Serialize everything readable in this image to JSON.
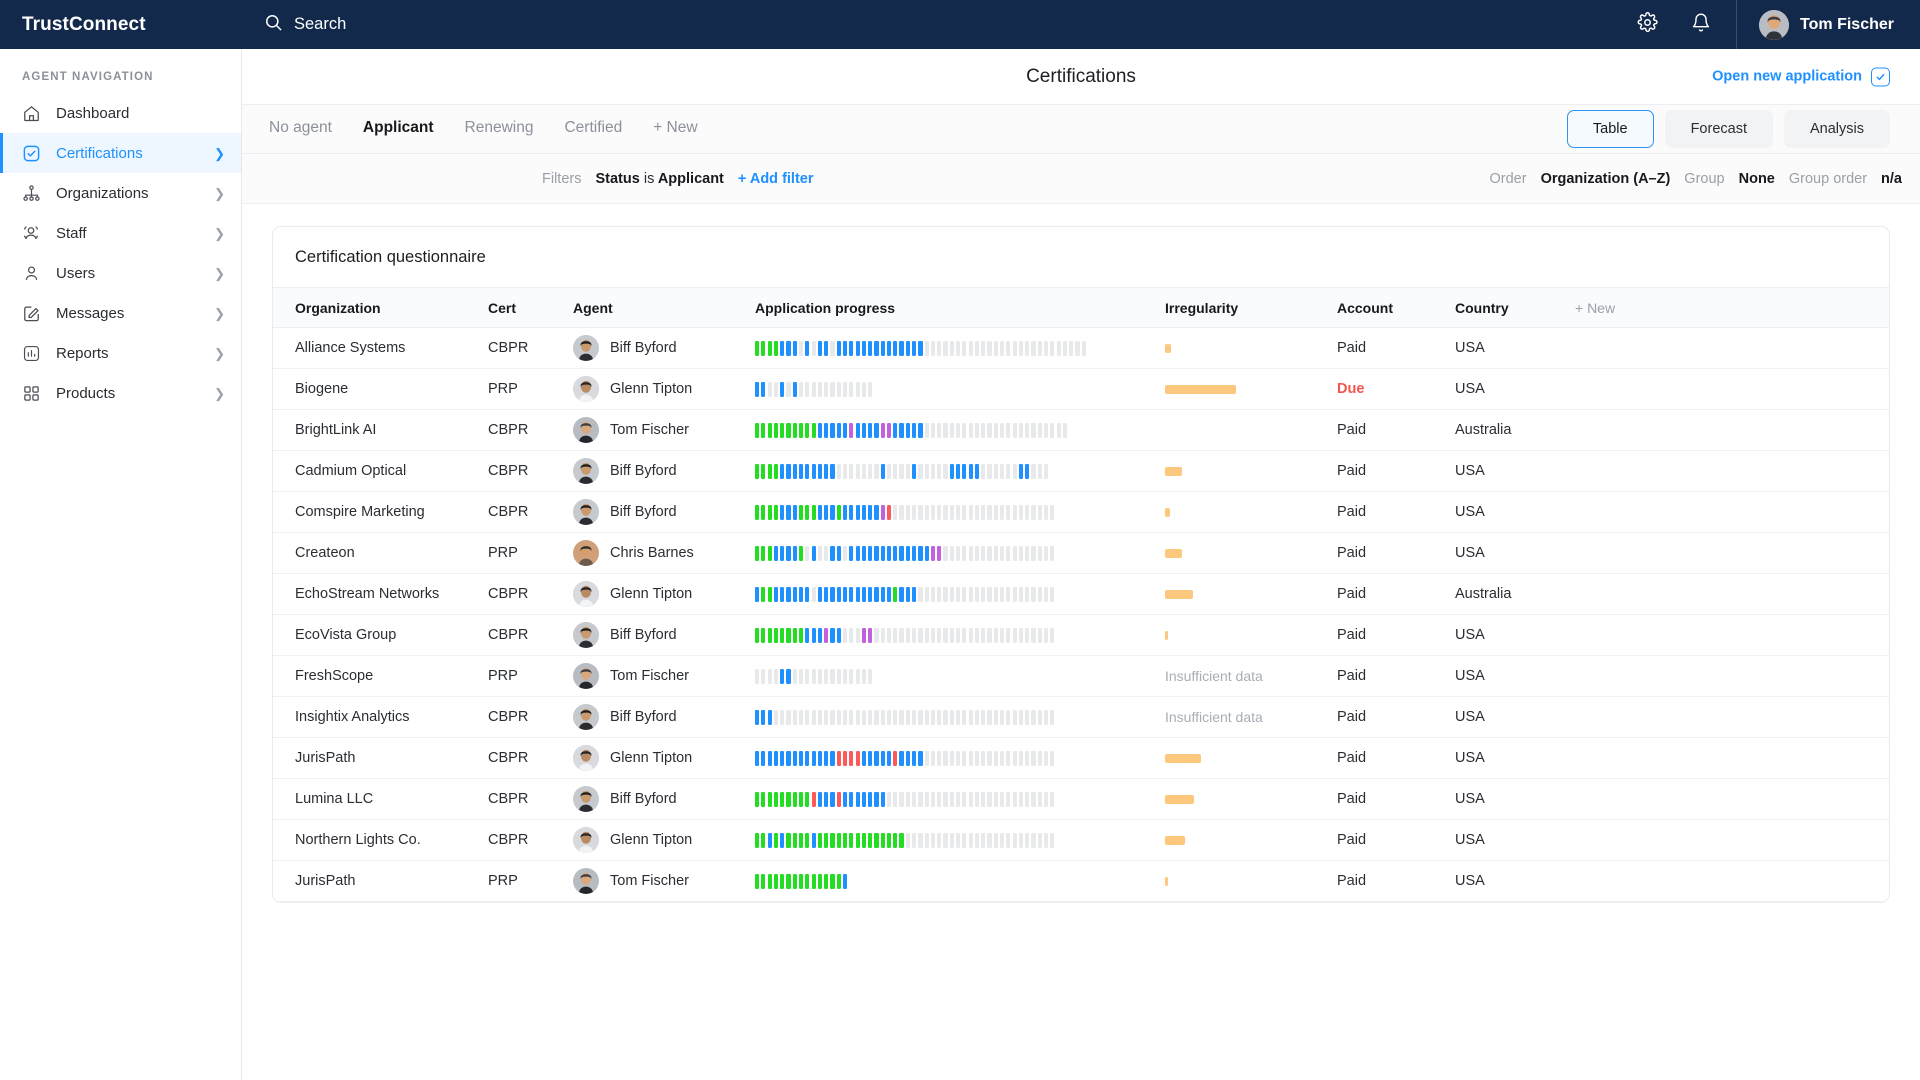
{
  "colors": {
    "navy": "#13294b",
    "accent": "#1e90ff",
    "green": "#22dd22",
    "blue": "#1e90ff",
    "purple": "#c161dd",
    "red": "#fc5a5a",
    "gray": "#e8e9eb",
    "amber": "#fbc87d",
    "due_red": "#f4564f"
  },
  "topbar": {
    "brand": "TrustConnect",
    "search_label": "Search",
    "search_icon": "search-icon",
    "settings_icon": "gear-icon",
    "notifications_icon": "bell-icon",
    "user_name": "Tom Fischer",
    "user_avatar": "avatar"
  },
  "sidebar": {
    "section_title": "AGENT NAVIGATION",
    "items": [
      {
        "label": "Dashboard",
        "icon": "home-icon",
        "chevron": false,
        "active": false
      },
      {
        "label": "Certifications",
        "icon": "check-square-icon",
        "chevron": true,
        "active": true
      },
      {
        "label": "Organizations",
        "icon": "org-tree-icon",
        "chevron": true,
        "active": false
      },
      {
        "label": "Staff",
        "icon": "people-icon",
        "chevron": true,
        "active": false
      },
      {
        "label": "Users",
        "icon": "user-icon",
        "chevron": true,
        "active": false
      },
      {
        "label": "Messages",
        "icon": "pencil-square-icon",
        "chevron": true,
        "active": false
      },
      {
        "label": "Reports",
        "icon": "bar-chart-icon",
        "chevron": true,
        "active": false
      },
      {
        "label": "Products",
        "icon": "grid-icon",
        "chevron": true,
        "active": false
      }
    ]
  },
  "page": {
    "title": "Certifications",
    "open_new_application": "Open new application",
    "open_new_icon": "check-square-icon"
  },
  "tabs": [
    {
      "label": "No agent",
      "active": false
    },
    {
      "label": "Applicant",
      "active": true
    },
    {
      "label": "Renewing",
      "active": false
    },
    {
      "label": "Certified",
      "active": false
    },
    {
      "label": "+ New",
      "active": false
    }
  ],
  "views": [
    {
      "label": "Table",
      "active": true
    },
    {
      "label": "Forecast",
      "active": false
    },
    {
      "label": "Analysis",
      "active": false
    }
  ],
  "filters": {
    "label": "Filters",
    "chip_field": "Status",
    "chip_operator": "is",
    "chip_value": "Applicant",
    "add_filter": "+ Add filter",
    "order_label": "Order",
    "order_value": "Organization (A–Z)",
    "group_label": "Group",
    "group_value": "None",
    "group_order_label": "Group order",
    "group_order_value": "n/a"
  },
  "table": {
    "card_title": "Certification questionnaire",
    "columns": [
      "Organization",
      "Cert",
      "Agent",
      "Application progress",
      "Irregularity",
      "Account",
      "Country",
      "+ New"
    ],
    "rows": [
      {
        "organization": "Alliance Systems",
        "cert": "CBPR",
        "agent": "Biff Byford",
        "avatar": "dark",
        "irregularity_pct": 4,
        "irregularity_text": "",
        "account": "Paid",
        "country": "USA",
        "progress": "GGGGBBB.B.BB.BBBBBBBBBBBBBB.........................."
      },
      {
        "organization": "Biogene",
        "cert": "PRP",
        "agent": "Glenn Tipton",
        "avatar": "light",
        "irregularity_pct": 46,
        "irregularity_text": "",
        "account": "Due",
        "country": "USA",
        "progress": "BB..B.B............"
      },
      {
        "organization": "BrightLink AI",
        "cert": "CBPR",
        "agent": "Tom Fischer",
        "avatar": "mid",
        "irregularity_pct": 0,
        "irregularity_text": "",
        "account": "Paid",
        "country": "Australia",
        "progress": "GGGGGGGGGGBBBBBPBBBBPPBBBBB......................."
      },
      {
        "organization": "Cadmium Optical",
        "cert": "CBPR",
        "agent": "Biff Byford",
        "avatar": "dark",
        "irregularity_pct": 11,
        "irregularity_text": "",
        "account": "Paid",
        "country": "USA",
        "progress": "GGGGBBBBBBBBB.......B....B.....BBBBB......BB..."
      },
      {
        "organization": "Comspire Marketing",
        "cert": "CBPR",
        "agent": "Biff Byford",
        "avatar": "dark",
        "irregularity_pct": 3,
        "irregularity_text": "",
        "account": "Paid",
        "country": "USA",
        "progress": "GGGGBBBGGGBBBGBBBBBBPR.........................."
      },
      {
        "organization": "Createon",
        "cert": "PRP",
        "agent": "Chris Barnes",
        "avatar": "warm",
        "irregularity_pct": 11,
        "irregularity_text": "",
        "account": "Paid",
        "country": "USA",
        "progress": "GGGBBBBG.B..BB.BBBBBBBBBBBBBPP.................."
      },
      {
        "organization": "EchoStream Networks",
        "cert": "CBPR",
        "agent": "Glenn Tipton",
        "avatar": "light",
        "irregularity_pct": 18,
        "irregularity_text": "",
        "account": "Paid",
        "country": "Australia",
        "progress": "BGGBBBBBB.BBBBBBBBBBBBGBBB......................"
      },
      {
        "organization": "EcoVista Group",
        "cert": "CBPR",
        "agent": "Biff Byford",
        "avatar": "dark",
        "irregularity_pct": 2,
        "irregularity_text": "",
        "account": "Paid",
        "country": "USA",
        "progress": "GGGGGGGGBBBPBB...PP............................."
      },
      {
        "organization": "FreshScope",
        "cert": "PRP",
        "agent": "Tom Fischer",
        "avatar": "mid",
        "irregularity_pct": 0,
        "irregularity_text": "Insufficient data",
        "account": "Paid",
        "country": "USA",
        "progress": "....BB............."
      },
      {
        "organization": "Insightix Analytics",
        "cert": "CBPR",
        "agent": "Biff Byford",
        "avatar": "dark",
        "irregularity_pct": 0,
        "irregularity_text": "Insufficient data",
        "account": "Paid",
        "country": "USA",
        "progress": "BBB............................................."
      },
      {
        "organization": "JurisPath",
        "cert": "CBPR",
        "agent": "Glenn Tipton",
        "avatar": "light",
        "irregularity_pct": 23,
        "irregularity_text": "",
        "account": "Paid",
        "country": "USA",
        "progress": "BBBBBBBBBBBBBRRRRBBBBBRBBBB....................."
      },
      {
        "organization": "Lumina LLC",
        "cert": "CBPR",
        "agent": "Biff Byford",
        "avatar": "dark",
        "irregularity_pct": 19,
        "irregularity_text": "",
        "account": "Paid",
        "country": "USA",
        "progress": "GGGGGGGGGRBBBRBBBBBBB..........................."
      },
      {
        "organization": "Northern Lights Co.",
        "cert": "CBPR",
        "agent": "Glenn Tipton",
        "avatar": "light",
        "irregularity_pct": 13,
        "irregularity_text": "",
        "account": "Paid",
        "country": "USA",
        "progress": "GGBGBGGGGBGGGGGGGGGGGGGG........................"
      },
      {
        "organization": "JurisPath",
        "cert": "PRP",
        "agent": "Tom Fischer",
        "avatar": "mid",
        "irregularity_pct": 2,
        "irregularity_text": "",
        "account": "Paid",
        "country": "USA",
        "progress": "GGGGGGGGGGGGGGB"
      }
    ]
  }
}
